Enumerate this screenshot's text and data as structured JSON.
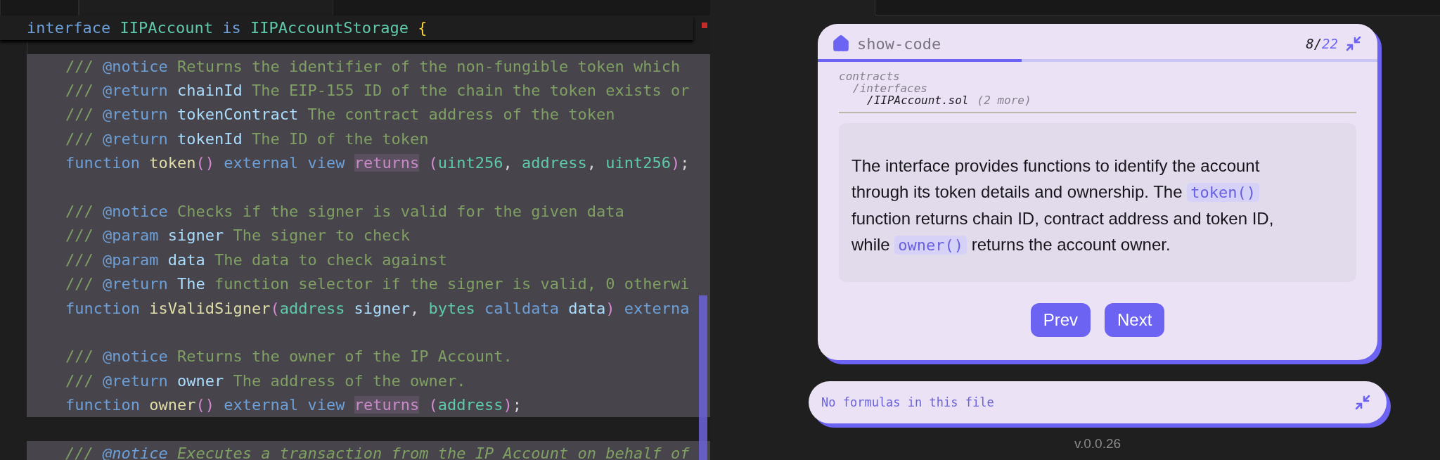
{
  "editor": {
    "header_line": [
      {
        "text": "interface",
        "kind": "kw"
      },
      {
        "text": " IIPAccount",
        "kind": "type"
      },
      {
        "text": " is",
        "kind": "kw"
      },
      {
        "text": " IIPAccountStorage",
        "kind": "type"
      },
      {
        "text": " {",
        "kind": "brace"
      }
    ],
    "lines": [
      {
        "selected": true,
        "italic": false,
        "tokens": [
          {
            "text": "/// ",
            "kind": "comment"
          },
          {
            "text": "@notice",
            "kind": "tag"
          },
          {
            "text": " Returns the identifier of the non-fungible token which",
            "kind": "comment"
          }
        ]
      },
      {
        "selected": true,
        "italic": false,
        "tokens": [
          {
            "text": "/// ",
            "kind": "comment"
          },
          {
            "text": "@return",
            "kind": "tag"
          },
          {
            "text": " chainId",
            "kind": "name"
          },
          {
            "text": " The EIP-155 ID of the chain the token exists or",
            "kind": "comment"
          }
        ]
      },
      {
        "selected": true,
        "italic": false,
        "tokens": [
          {
            "text": "/// ",
            "kind": "comment"
          },
          {
            "text": "@return",
            "kind": "tag"
          },
          {
            "text": " tokenContract",
            "kind": "name"
          },
          {
            "text": " The contract address of the token",
            "kind": "comment"
          }
        ]
      },
      {
        "selected": true,
        "italic": false,
        "tokens": [
          {
            "text": "/// ",
            "kind": "comment"
          },
          {
            "text": "@return",
            "kind": "tag"
          },
          {
            "text": " tokenId",
            "kind": "name"
          },
          {
            "text": " The ID of the token",
            "kind": "comment"
          }
        ]
      },
      {
        "selected": true,
        "italic": false,
        "tokens": [
          {
            "text": "function",
            "kind": "kw"
          },
          {
            "text": " token",
            "kind": "fn"
          },
          {
            "text": "()",
            "kind": "paren"
          },
          {
            "text": " external view ",
            "kind": "kw"
          },
          {
            "text": "returns",
            "kind": "returns"
          },
          {
            "text": " (",
            "kind": "paren"
          },
          {
            "text": "uint256",
            "kind": "type"
          },
          {
            "text": ",",
            "kind": "plain"
          },
          {
            "text": " address",
            "kind": "type"
          },
          {
            "text": ",",
            "kind": "plain"
          },
          {
            "text": " uint256",
            "kind": "type"
          },
          {
            "text": ")",
            "kind": "paren"
          },
          {
            "text": ";",
            "kind": "plain"
          }
        ]
      },
      {
        "selected": true
      },
      {
        "selected": true,
        "italic": false,
        "tokens": [
          {
            "text": "/// ",
            "kind": "comment"
          },
          {
            "text": "@notice",
            "kind": "tag"
          },
          {
            "text": " Checks if the signer is valid for the given data",
            "kind": "comment"
          }
        ]
      },
      {
        "selected": true,
        "italic": false,
        "tokens": [
          {
            "text": "/// ",
            "kind": "comment"
          },
          {
            "text": "@param",
            "kind": "tag"
          },
          {
            "text": " signer",
            "kind": "name"
          },
          {
            "text": " The signer to check",
            "kind": "comment"
          }
        ]
      },
      {
        "selected": true,
        "italic": false,
        "tokens": [
          {
            "text": "/// ",
            "kind": "comment"
          },
          {
            "text": "@param",
            "kind": "tag"
          },
          {
            "text": " data",
            "kind": "name"
          },
          {
            "text": " The data to check against",
            "kind": "comment"
          }
        ]
      },
      {
        "selected": true,
        "italic": false,
        "tokens": [
          {
            "text": "/// ",
            "kind": "comment"
          },
          {
            "text": "@return",
            "kind": "tag"
          },
          {
            "text": " The",
            "kind": "name"
          },
          {
            "text": " function selector if the signer is valid, 0 otherwi",
            "kind": "comment"
          }
        ]
      },
      {
        "selected": true,
        "italic": false,
        "tokens": [
          {
            "text": "function",
            "kind": "kw"
          },
          {
            "text": " isValidSigner",
            "kind": "fn"
          },
          {
            "text": "(",
            "kind": "paren"
          },
          {
            "text": "address",
            "kind": "type"
          },
          {
            "text": " signer",
            "kind": "name"
          },
          {
            "text": ",",
            "kind": "plain"
          },
          {
            "text": " bytes",
            "kind": "type"
          },
          {
            "text": " calldata",
            "kind": "kw"
          },
          {
            "text": " data",
            "kind": "name"
          },
          {
            "text": ")",
            "kind": "paren"
          },
          {
            "text": " externa",
            "kind": "kw"
          }
        ]
      },
      {
        "selected": true
      },
      {
        "selected": true,
        "italic": false,
        "tokens": [
          {
            "text": "/// ",
            "kind": "comment"
          },
          {
            "text": "@notice",
            "kind": "tag"
          },
          {
            "text": " Returns the owner of the IP Account.",
            "kind": "comment"
          }
        ]
      },
      {
        "selected": true,
        "italic": false,
        "tokens": [
          {
            "text": "/// ",
            "kind": "comment"
          },
          {
            "text": "@return",
            "kind": "tag"
          },
          {
            "text": " owner",
            "kind": "name"
          },
          {
            "text": " The address of the owner.",
            "kind": "comment"
          }
        ]
      },
      {
        "selected": true,
        "italic": false,
        "tokens": [
          {
            "text": "function",
            "kind": "kw"
          },
          {
            "text": " owner",
            "kind": "fn"
          },
          {
            "text": "()",
            "kind": "paren"
          },
          {
            "text": " external view ",
            "kind": "kw"
          },
          {
            "text": "returns",
            "kind": "returns"
          },
          {
            "text": " (",
            "kind": "paren"
          },
          {
            "text": "address",
            "kind": "type"
          },
          {
            "text": ")",
            "kind": "paren"
          },
          {
            "text": ";",
            "kind": "plain"
          }
        ]
      },
      {
        "selected": false
      },
      {
        "selected": true,
        "italic": true,
        "tokens": [
          {
            "text": "/// ",
            "kind": "comment"
          },
          {
            "text": "@notice",
            "kind": "tag"
          },
          {
            "text": " Executes a transaction from the IP Account on behalf of",
            "kind": "comment"
          }
        ]
      }
    ]
  },
  "tour": {
    "title": "show-code",
    "step": "8/",
    "total": "22",
    "progress": {
      "level": 0.364
    },
    "path": {
      "label": "contracts",
      "children": [
        {
          "label": "/interfaces",
          "children": [
            {
              "label": "/IIPAccount.sol",
              "note": "(2 more)"
            }
          ]
        }
      ]
    },
    "explanation": [
      {
        "text": "The interface provides functions to identify the account through its token details and ownership. The ",
        "kind": "text"
      },
      {
        "text": "token()",
        "kind": "code"
      },
      {
        "text": " function returns chain ID, contract address and token ID, while ",
        "kind": "text"
      },
      {
        "text": "owner()",
        "kind": "code"
      },
      {
        "text": " returns the account owner.",
        "kind": "text"
      }
    ],
    "buttons": [
      "Prev",
      "Next"
    ]
  },
  "formulas": {
    "message": "No formulas in this file"
  },
  "version": "v.0.0.26"
}
